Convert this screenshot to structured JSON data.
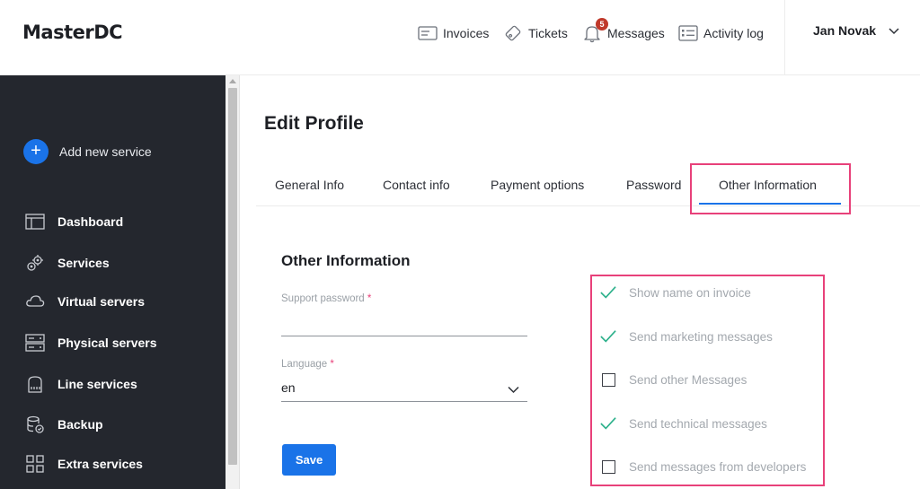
{
  "brand": {
    "logo": "MasterDC"
  },
  "header": {
    "nav": [
      {
        "label": "Invoices",
        "icon": "invoice-icon"
      },
      {
        "label": "Tickets",
        "icon": "ticket-icon"
      },
      {
        "label": "Messages",
        "icon": "bell-icon",
        "badge": "5"
      },
      {
        "label": "Activity log",
        "icon": "activity-log-icon"
      }
    ],
    "user": {
      "name": "Jan Novak",
      "icon": "chevron-down-icon"
    }
  },
  "sidebar": {
    "add_service": "Add new service",
    "items": [
      {
        "label": "Dashboard",
        "icon": "dashboard-icon"
      },
      {
        "label": "Services",
        "icon": "gears-icon"
      },
      {
        "label": "Virtual servers",
        "icon": "cloud-icon"
      },
      {
        "label": "Physical servers",
        "icon": "server-rack-icon"
      },
      {
        "label": "Line services",
        "icon": "router-icon"
      },
      {
        "label": "Backup",
        "icon": "database-icon"
      },
      {
        "label": "Extra services",
        "icon": "grid-icon"
      }
    ]
  },
  "main": {
    "title": "Edit Profile",
    "tabs": [
      {
        "label": "General Info",
        "active": false
      },
      {
        "label": "Contact info",
        "active": false
      },
      {
        "label": "Payment options",
        "active": false
      },
      {
        "label": "Password",
        "active": false
      },
      {
        "label": "Other Information",
        "active": true
      }
    ],
    "section_title": "Other Information",
    "support_password": {
      "label": "Support password",
      "required_mark": "*",
      "value": ""
    },
    "language": {
      "label": "Language",
      "required_mark": "*",
      "value": "en"
    },
    "save_label": "Save",
    "options": [
      {
        "label": "Show name on invoice",
        "checked": true
      },
      {
        "label": "Send marketing messages",
        "checked": true
      },
      {
        "label": "Send other Messages",
        "checked": false
      },
      {
        "label": "Send technical messages",
        "checked": true
      },
      {
        "label": "Send messages from developers",
        "checked": false
      }
    ]
  },
  "colors": {
    "accent": "#1a73e8",
    "sidebar_bg": "#24272e",
    "highlight": "#e8417a",
    "check": "#2bb08a",
    "badge": "#c0392b"
  }
}
